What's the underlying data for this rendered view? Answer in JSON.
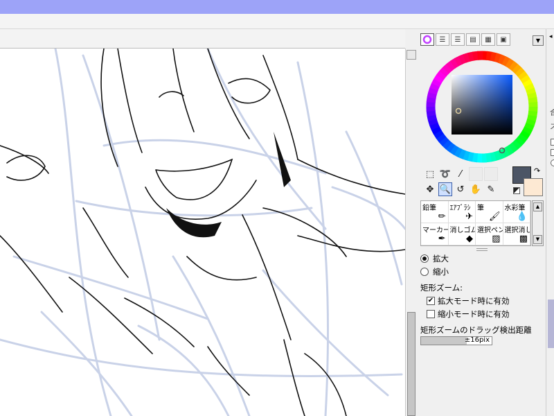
{
  "panel": {
    "tabs": [
      "color-wheel-tab",
      "rgb-slider-tab",
      "hsv-slider-tab",
      "palette-tab",
      "swatch-grid-tab",
      "scratchpad-tab"
    ],
    "active_tab": "color-wheel-tab",
    "menu_icon": "dropdown-icon"
  },
  "colors": {
    "main": "#4c5565",
    "sub": "#fde9d3",
    "accent_title": "#9da3f8"
  },
  "tools": [
    "rect-select-icon",
    "lasso-icon",
    "magic-wand-icon",
    "move-icon",
    "zoom-icon",
    "rotate-icon",
    "hand-icon",
    "eyedropper-icon"
  ],
  "selected_tool": "zoom-icon",
  "brushes": [
    {
      "label": "鉛筆",
      "icon": "pencil-icon"
    },
    {
      "label": "ｴｱﾌﾞﾗｼ",
      "icon": "airbrush-icon"
    },
    {
      "label": "筆",
      "icon": "brush-icon"
    },
    {
      "label": "水彩筆",
      "icon": "watercolor-icon"
    },
    {
      "label": "マーカー",
      "icon": "marker-icon"
    },
    {
      "label": "消しゴム",
      "icon": "eraser-icon"
    },
    {
      "label": "選択ペン",
      "icon": "select-pen-icon"
    },
    {
      "label": "選択消し",
      "icon": "select-eraser-icon"
    }
  ],
  "zoom_options": {
    "zoom_in_label": "拡大",
    "zoom_out_label": "縮小",
    "zoom_in_selected": true,
    "rect_zoom_label": "矩形ズーム:",
    "enable_in_zoom_in": "拡大モード時に有効",
    "enable_in_zoom_in_checked": true,
    "enable_in_zoom_out": "縮小モード時に有効",
    "enable_in_zoom_out_checked": false,
    "drag_distance_label": "矩形ズームのドラッグ検出距離",
    "drag_distance_value": "±16pix",
    "drag_distance_fraction": 0.65
  },
  "right_strip": {
    "chars": [
      "合",
      "ス"
    ]
  }
}
